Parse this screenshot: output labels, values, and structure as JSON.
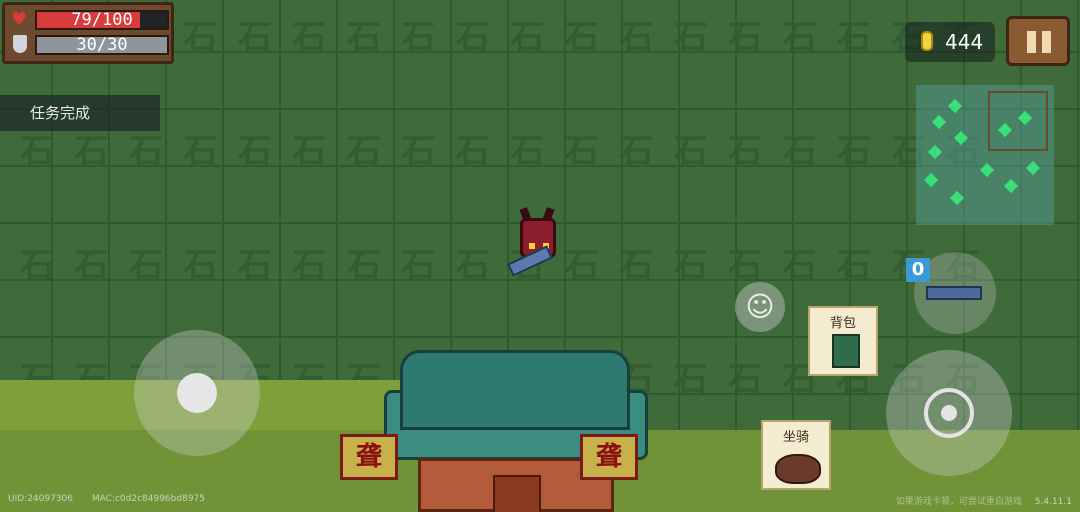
{
  "hud": {
    "hp_text": "79/100",
    "hp_fraction": 0.79,
    "shield_text": "30/30",
    "shield_fraction": 1.0,
    "colors": {
      "hp": "#d93a3a",
      "shield": "#8e959d"
    }
  },
  "quest": {
    "label": "任务完成"
  },
  "coins": {
    "value": "444"
  },
  "weapon": {
    "ammo": "0"
  },
  "buttons": {
    "backpack_label": "背包",
    "mount_label": "坐骑"
  },
  "temple": {
    "banner_left": "聋",
    "banner_right": "聋"
  },
  "footer": {
    "uid": "UID:24097306",
    "mac": "MAC:c0d2c84996bd8975",
    "hint": "如果游戏卡顿，可尝试重启游戏",
    "version": "5.4.11.1"
  },
  "icons": {
    "heart": "heart-icon",
    "shield": "shield-icon",
    "coin": "coin-icon",
    "pause": "pause-icon",
    "emote": "smiley-icon",
    "fire": "crosshair-icon"
  }
}
